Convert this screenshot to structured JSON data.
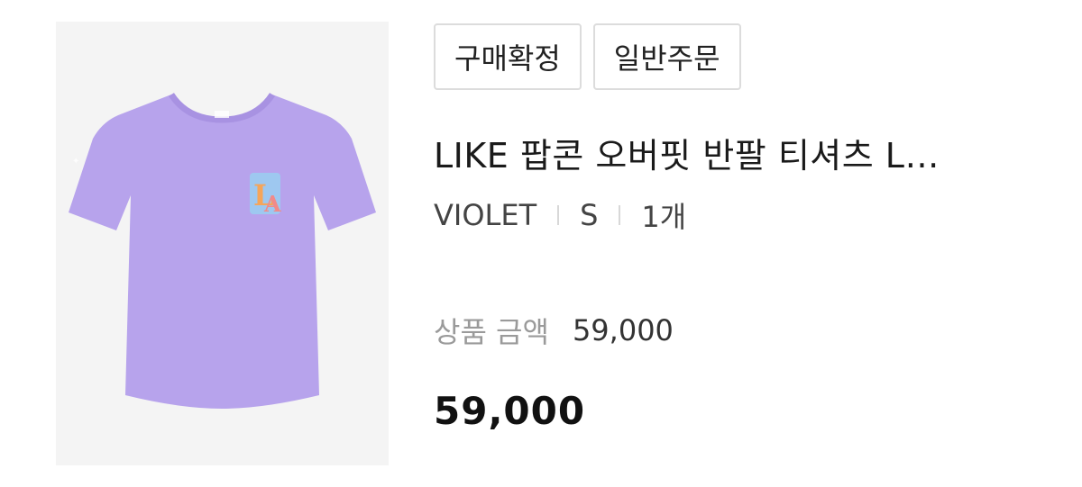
{
  "order": {
    "badges": [
      {
        "label": "구매확정"
      },
      {
        "label": "일반주문"
      }
    ],
    "product": {
      "title": "LIKE 팝콘 오버핏 반팔 티셔츠 L…",
      "options": {
        "color": "VIOLET",
        "size": "S",
        "quantity": "1개"
      },
      "price_label": "상품 금액",
      "price_value": "59,000",
      "total": "59,000"
    }
  },
  "colors": {
    "shirt": "#b7a3ec",
    "image_bg": "#f4f4f4"
  }
}
